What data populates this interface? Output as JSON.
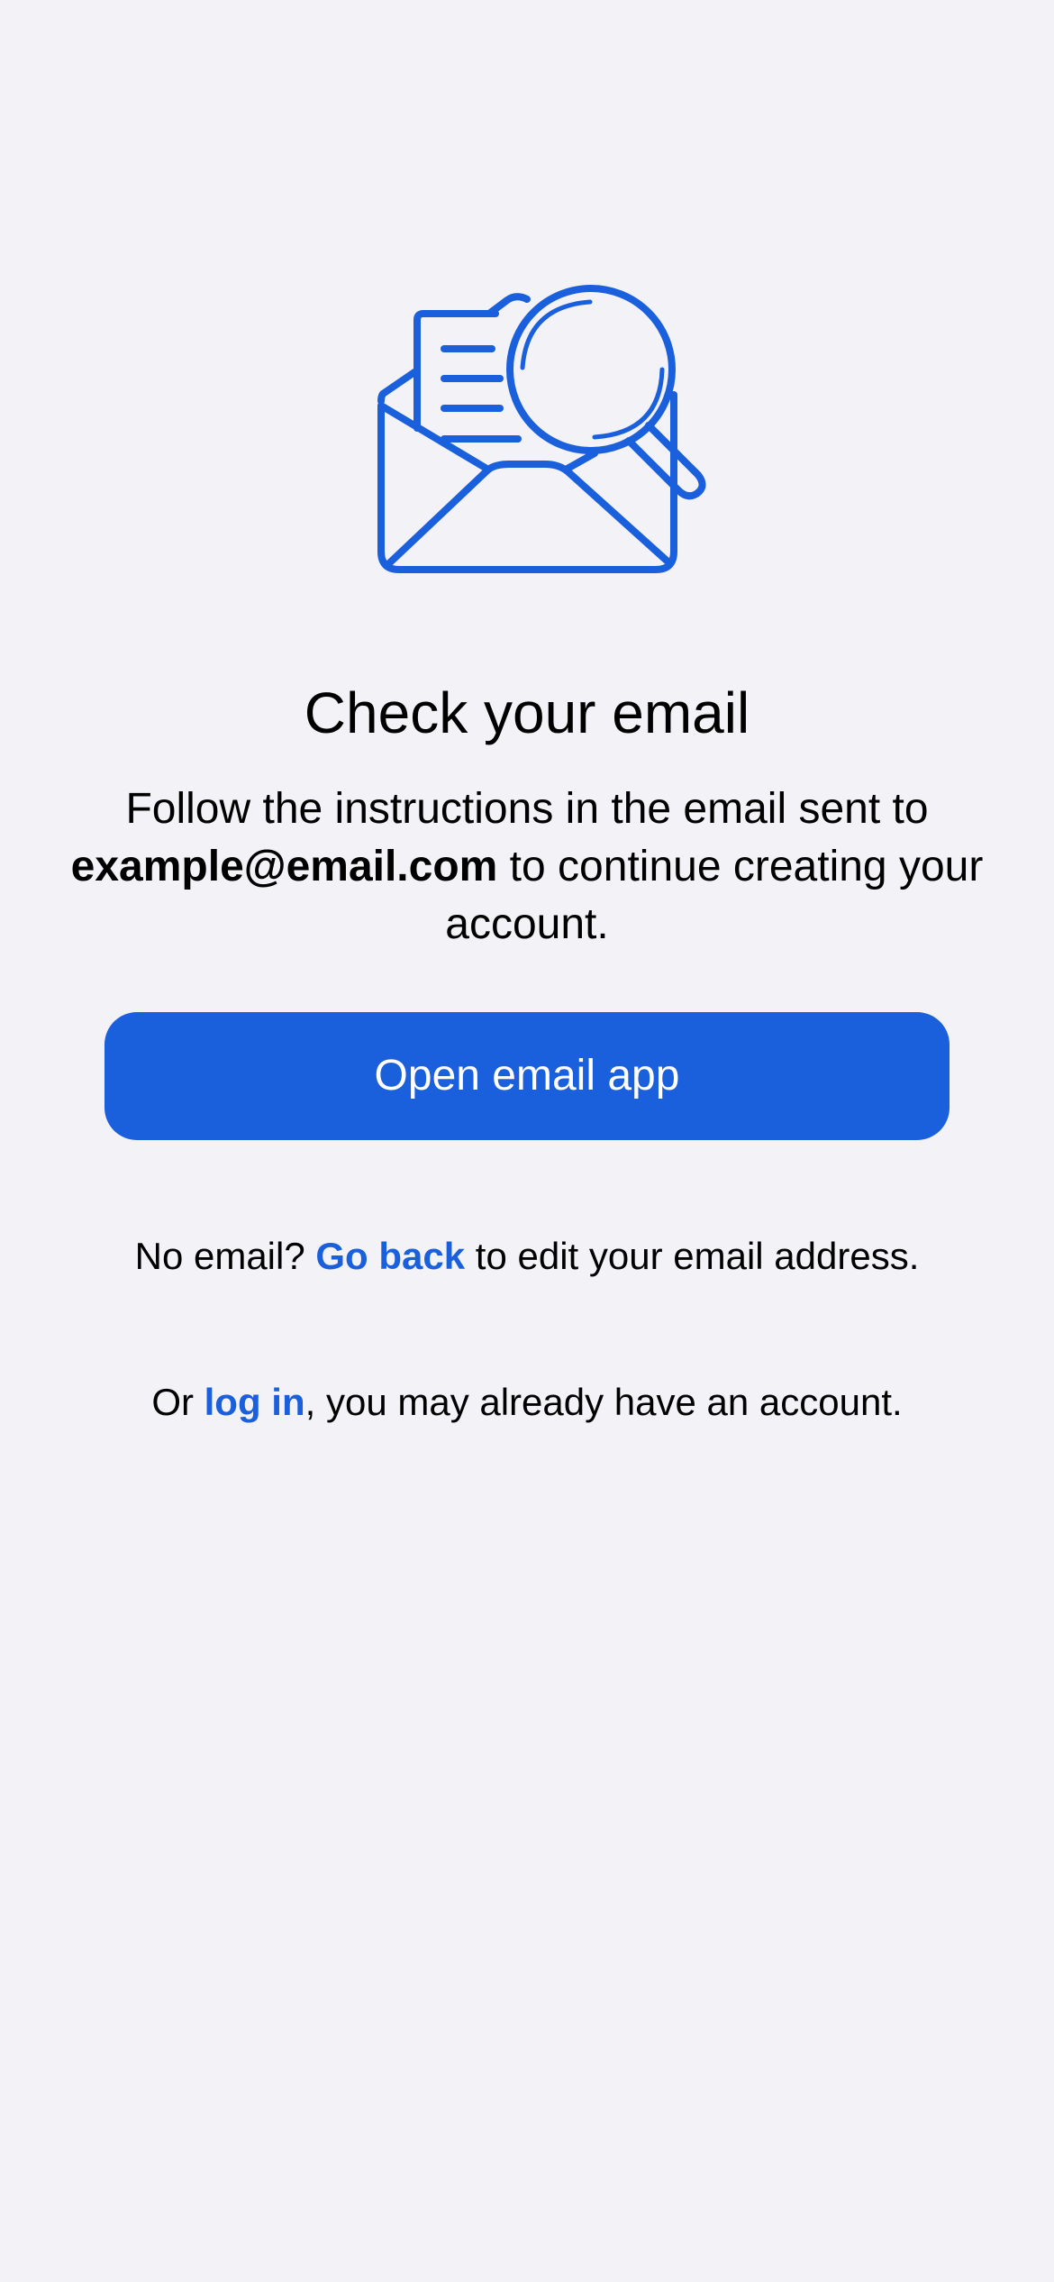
{
  "illustration": {
    "icon": "envelope-magnifier-icon",
    "color": "#1a5fdb"
  },
  "heading": {
    "title": "Check your email"
  },
  "message": {
    "line_before": "Follow the instructions in the email sent to",
    "email": "example@email.com",
    "line_after": " to continue creating your account."
  },
  "primary_action": {
    "label": "Open email app",
    "color": "#1a5fdb"
  },
  "no_email": {
    "prefix": "No email? ",
    "link": "Go back",
    "suffix": " to edit your email address."
  },
  "login": {
    "prefix": "Or ",
    "link": "log in",
    "suffix": ", you may already have an account."
  },
  "colors": {
    "background": "#f2f2f7",
    "accent": "#1a5fdb",
    "text": "#000000"
  }
}
